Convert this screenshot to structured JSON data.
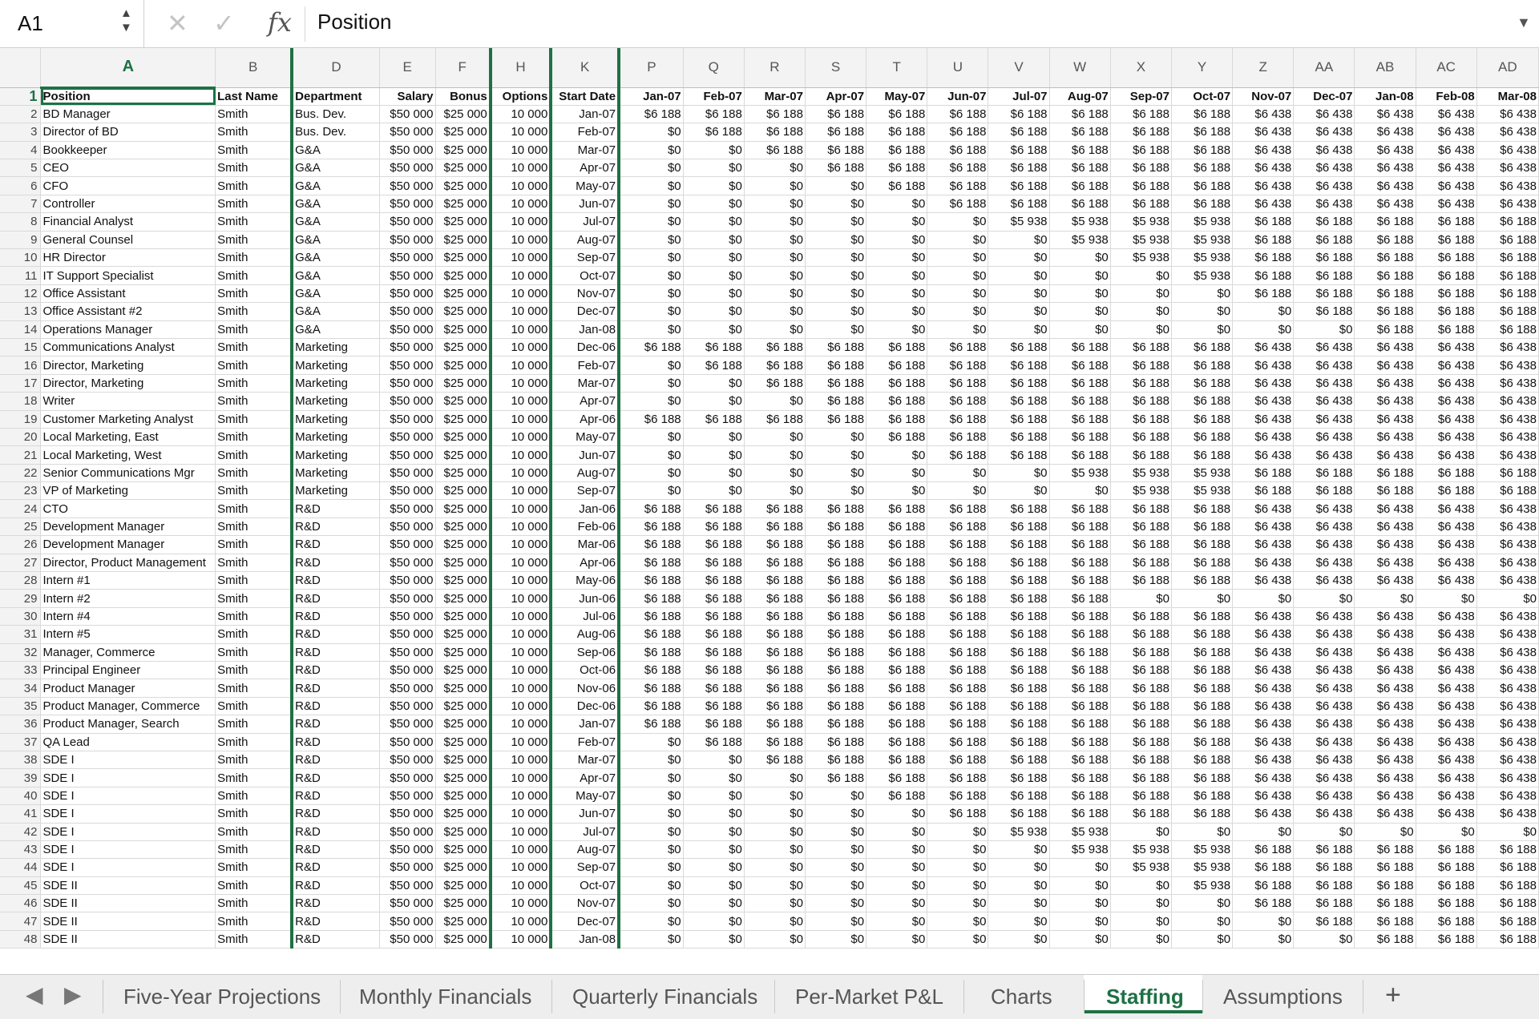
{
  "formula_bar": {
    "name_box": "A1",
    "fx_label": "fx",
    "formula": "Position"
  },
  "columns": [
    "A",
    "B",
    "D",
    "E",
    "F",
    "H",
    "K",
    "P",
    "Q",
    "R",
    "S",
    "T",
    "U",
    "V",
    "W",
    "X",
    "Y",
    "Z",
    "AA",
    "AB",
    "AC",
    "AD"
  ],
  "headers": [
    "Position",
    "Last Name",
    "Department",
    "Salary",
    "Bonus",
    "Options",
    "Start Date",
    "Jan-07",
    "Feb-07",
    "Mar-07",
    "Apr-07",
    "May-07",
    "Jun-07",
    "Jul-07",
    "Aug-07",
    "Sep-07",
    "Oct-07",
    "Nov-07",
    "Dec-07",
    "Jan-08",
    "Feb-08",
    "Mar-08"
  ],
  "rows": [
    [
      "BD Manager",
      "Smith",
      "Bus. Dev.",
      "$50 000",
      "$25 000",
      "10 000",
      "Jan-07",
      "$6 188",
      "$6 188",
      "$6 188",
      "$6 188",
      "$6 188",
      "$6 188",
      "$6 188",
      "$6 188",
      "$6 188",
      "$6 188",
      "$6 438",
      "$6 438",
      "$6 438",
      "$6 438",
      "$6 438"
    ],
    [
      "Director of BD",
      "Smith",
      "Bus. Dev.",
      "$50 000",
      "$25 000",
      "10 000",
      "Feb-07",
      "$0",
      "$6 188",
      "$6 188",
      "$6 188",
      "$6 188",
      "$6 188",
      "$6 188",
      "$6 188",
      "$6 188",
      "$6 188",
      "$6 438",
      "$6 438",
      "$6 438",
      "$6 438",
      "$6 438"
    ],
    [
      "Bookkeeper",
      "Smith",
      "G&A",
      "$50 000",
      "$25 000",
      "10 000",
      "Mar-07",
      "$0",
      "$0",
      "$6 188",
      "$6 188",
      "$6 188",
      "$6 188",
      "$6 188",
      "$6 188",
      "$6 188",
      "$6 188",
      "$6 438",
      "$6 438",
      "$6 438",
      "$6 438",
      "$6 438"
    ],
    [
      "CEO",
      "Smith",
      "G&A",
      "$50 000",
      "$25 000",
      "10 000",
      "Apr-07",
      "$0",
      "$0",
      "$0",
      "$6 188",
      "$6 188",
      "$6 188",
      "$6 188",
      "$6 188",
      "$6 188",
      "$6 188",
      "$6 438",
      "$6 438",
      "$6 438",
      "$6 438",
      "$6 438"
    ],
    [
      "CFO",
      "Smith",
      "G&A",
      "$50 000",
      "$25 000",
      "10 000",
      "May-07",
      "$0",
      "$0",
      "$0",
      "$0",
      "$6 188",
      "$6 188",
      "$6 188",
      "$6 188",
      "$6 188",
      "$6 188",
      "$6 438",
      "$6 438",
      "$6 438",
      "$6 438",
      "$6 438"
    ],
    [
      "Controller",
      "Smith",
      "G&A",
      "$50 000",
      "$25 000",
      "10 000",
      "Jun-07",
      "$0",
      "$0",
      "$0",
      "$0",
      "$0",
      "$6 188",
      "$6 188",
      "$6 188",
      "$6 188",
      "$6 188",
      "$6 438",
      "$6 438",
      "$6 438",
      "$6 438",
      "$6 438"
    ],
    [
      "Financial Analyst",
      "Smith",
      "G&A",
      "$50 000",
      "$25 000",
      "10 000",
      "Jul-07",
      "$0",
      "$0",
      "$0",
      "$0",
      "$0",
      "$0",
      "$5 938",
      "$5 938",
      "$5 938",
      "$5 938",
      "$6 188",
      "$6 188",
      "$6 188",
      "$6 188",
      "$6 188"
    ],
    [
      "General Counsel",
      "Smith",
      "G&A",
      "$50 000",
      "$25 000",
      "10 000",
      "Aug-07",
      "$0",
      "$0",
      "$0",
      "$0",
      "$0",
      "$0",
      "$0",
      "$5 938",
      "$5 938",
      "$5 938",
      "$6 188",
      "$6 188",
      "$6 188",
      "$6 188",
      "$6 188"
    ],
    [
      "HR Director",
      "Smith",
      "G&A",
      "$50 000",
      "$25 000",
      "10 000",
      "Sep-07",
      "$0",
      "$0",
      "$0",
      "$0",
      "$0",
      "$0",
      "$0",
      "$0",
      "$5 938",
      "$5 938",
      "$6 188",
      "$6 188",
      "$6 188",
      "$6 188",
      "$6 188"
    ],
    [
      "IT Support Specialist",
      "Smith",
      "G&A",
      "$50 000",
      "$25 000",
      "10 000",
      "Oct-07",
      "$0",
      "$0",
      "$0",
      "$0",
      "$0",
      "$0",
      "$0",
      "$0",
      "$0",
      "$5 938",
      "$6 188",
      "$6 188",
      "$6 188",
      "$6 188",
      "$6 188"
    ],
    [
      "Office Assistant",
      "Smith",
      "G&A",
      "$50 000",
      "$25 000",
      "10 000",
      "Nov-07",
      "$0",
      "$0",
      "$0",
      "$0",
      "$0",
      "$0",
      "$0",
      "$0",
      "$0",
      "$0",
      "$6 188",
      "$6 188",
      "$6 188",
      "$6 188",
      "$6 188"
    ],
    [
      "Office Assistant #2",
      "Smith",
      "G&A",
      "$50 000",
      "$25 000",
      "10 000",
      "Dec-07",
      "$0",
      "$0",
      "$0",
      "$0",
      "$0",
      "$0",
      "$0",
      "$0",
      "$0",
      "$0",
      "$0",
      "$6 188",
      "$6 188",
      "$6 188",
      "$6 188"
    ],
    [
      "Operations Manager",
      "Smith",
      "G&A",
      "$50 000",
      "$25 000",
      "10 000",
      "Jan-08",
      "$0",
      "$0",
      "$0",
      "$0",
      "$0",
      "$0",
      "$0",
      "$0",
      "$0",
      "$0",
      "$0",
      "$0",
      "$6 188",
      "$6 188",
      "$6 188"
    ],
    [
      "Communications Analyst",
      "Smith",
      "Marketing",
      "$50 000",
      "$25 000",
      "10 000",
      "Dec-06",
      "$6 188",
      "$6 188",
      "$6 188",
      "$6 188",
      "$6 188",
      "$6 188",
      "$6 188",
      "$6 188",
      "$6 188",
      "$6 188",
      "$6 438",
      "$6 438",
      "$6 438",
      "$6 438",
      "$6 438"
    ],
    [
      "Director, Marketing",
      "Smith",
      "Marketing",
      "$50 000",
      "$25 000",
      "10 000",
      "Feb-07",
      "$0",
      "$6 188",
      "$6 188",
      "$6 188",
      "$6 188",
      "$6 188",
      "$6 188",
      "$6 188",
      "$6 188",
      "$6 188",
      "$6 438",
      "$6 438",
      "$6 438",
      "$6 438",
      "$6 438"
    ],
    [
      "Director, Marketing",
      "Smith",
      "Marketing",
      "$50 000",
      "$25 000",
      "10 000",
      "Mar-07",
      "$0",
      "$0",
      "$6 188",
      "$6 188",
      "$6 188",
      "$6 188",
      "$6 188",
      "$6 188",
      "$6 188",
      "$6 188",
      "$6 438",
      "$6 438",
      "$6 438",
      "$6 438",
      "$6 438"
    ],
    [
      "Writer",
      "Smith",
      "Marketing",
      "$50 000",
      "$25 000",
      "10 000",
      "Apr-07",
      "$0",
      "$0",
      "$0",
      "$6 188",
      "$6 188",
      "$6 188",
      "$6 188",
      "$6 188",
      "$6 188",
      "$6 188",
      "$6 438",
      "$6 438",
      "$6 438",
      "$6 438",
      "$6 438"
    ],
    [
      "Customer Marketing Analyst",
      "Smith",
      "Marketing",
      "$50 000",
      "$25 000",
      "10 000",
      "Apr-06",
      "$6 188",
      "$6 188",
      "$6 188",
      "$6 188",
      "$6 188",
      "$6 188",
      "$6 188",
      "$6 188",
      "$6 188",
      "$6 188",
      "$6 438",
      "$6 438",
      "$6 438",
      "$6 438",
      "$6 438"
    ],
    [
      "Local Marketing, East",
      "Smith",
      "Marketing",
      "$50 000",
      "$25 000",
      "10 000",
      "May-07",
      "$0",
      "$0",
      "$0",
      "$0",
      "$6 188",
      "$6 188",
      "$6 188",
      "$6 188",
      "$6 188",
      "$6 188",
      "$6 438",
      "$6 438",
      "$6 438",
      "$6 438",
      "$6 438"
    ],
    [
      "Local Marketing, West",
      "Smith",
      "Marketing",
      "$50 000",
      "$25 000",
      "10 000",
      "Jun-07",
      "$0",
      "$0",
      "$0",
      "$0",
      "$0",
      "$6 188",
      "$6 188",
      "$6 188",
      "$6 188",
      "$6 188",
      "$6 438",
      "$6 438",
      "$6 438",
      "$6 438",
      "$6 438"
    ],
    [
      "Senior Communications Mgr",
      "Smith",
      "Marketing",
      "$50 000",
      "$25 000",
      "10 000",
      "Aug-07",
      "$0",
      "$0",
      "$0",
      "$0",
      "$0",
      "$0",
      "$0",
      "$5 938",
      "$5 938",
      "$5 938",
      "$6 188",
      "$6 188",
      "$6 188",
      "$6 188",
      "$6 188"
    ],
    [
      "VP of Marketing",
      "Smith",
      "Marketing",
      "$50 000",
      "$25 000",
      "10 000",
      "Sep-07",
      "$0",
      "$0",
      "$0",
      "$0",
      "$0",
      "$0",
      "$0",
      "$0",
      "$5 938",
      "$5 938",
      "$6 188",
      "$6 188",
      "$6 188",
      "$6 188",
      "$6 188"
    ],
    [
      "CTO",
      "Smith",
      "R&D",
      "$50 000",
      "$25 000",
      "10 000",
      "Jan-06",
      "$6 188",
      "$6 188",
      "$6 188",
      "$6 188",
      "$6 188",
      "$6 188",
      "$6 188",
      "$6 188",
      "$6 188",
      "$6 188",
      "$6 438",
      "$6 438",
      "$6 438",
      "$6 438",
      "$6 438"
    ],
    [
      "Development Manager",
      "Smith",
      "R&D",
      "$50 000",
      "$25 000",
      "10 000",
      "Feb-06",
      "$6 188",
      "$6 188",
      "$6 188",
      "$6 188",
      "$6 188",
      "$6 188",
      "$6 188",
      "$6 188",
      "$6 188",
      "$6 188",
      "$6 438",
      "$6 438",
      "$6 438",
      "$6 438",
      "$6 438"
    ],
    [
      "Development Manager",
      "Smith",
      "R&D",
      "$50 000",
      "$25 000",
      "10 000",
      "Mar-06",
      "$6 188",
      "$6 188",
      "$6 188",
      "$6 188",
      "$6 188",
      "$6 188",
      "$6 188",
      "$6 188",
      "$6 188",
      "$6 188",
      "$6 438",
      "$6 438",
      "$6 438",
      "$6 438",
      "$6 438"
    ],
    [
      "Director, Product Management",
      "Smith",
      "R&D",
      "$50 000",
      "$25 000",
      "10 000",
      "Apr-06",
      "$6 188",
      "$6 188",
      "$6 188",
      "$6 188",
      "$6 188",
      "$6 188",
      "$6 188",
      "$6 188",
      "$6 188",
      "$6 188",
      "$6 438",
      "$6 438",
      "$6 438",
      "$6 438",
      "$6 438"
    ],
    [
      "Intern #1",
      "Smith",
      "R&D",
      "$50 000",
      "$25 000",
      "10 000",
      "May-06",
      "$6 188",
      "$6 188",
      "$6 188",
      "$6 188",
      "$6 188",
      "$6 188",
      "$6 188",
      "$6 188",
      "$6 188",
      "$6 188",
      "$6 438",
      "$6 438",
      "$6 438",
      "$6 438",
      "$6 438"
    ],
    [
      "Intern #2",
      "Smith",
      "R&D",
      "$50 000",
      "$25 000",
      "10 000",
      "Jun-06",
      "$6 188",
      "$6 188",
      "$6 188",
      "$6 188",
      "$6 188",
      "$6 188",
      "$6 188",
      "$6 188",
      "$0",
      "$0",
      "$0",
      "$0",
      "$0",
      "$0",
      "$0"
    ],
    [
      "Intern #4",
      "Smith",
      "R&D",
      "$50 000",
      "$25 000",
      "10 000",
      "Jul-06",
      "$6 188",
      "$6 188",
      "$6 188",
      "$6 188",
      "$6 188",
      "$6 188",
      "$6 188",
      "$6 188",
      "$6 188",
      "$6 188",
      "$6 438",
      "$6 438",
      "$6 438",
      "$6 438",
      "$6 438"
    ],
    [
      "Intern #5",
      "Smith",
      "R&D",
      "$50 000",
      "$25 000",
      "10 000",
      "Aug-06",
      "$6 188",
      "$6 188",
      "$6 188",
      "$6 188",
      "$6 188",
      "$6 188",
      "$6 188",
      "$6 188",
      "$6 188",
      "$6 188",
      "$6 438",
      "$6 438",
      "$6 438",
      "$6 438",
      "$6 438"
    ],
    [
      "Manager, Commerce",
      "Smith",
      "R&D",
      "$50 000",
      "$25 000",
      "10 000",
      "Sep-06",
      "$6 188",
      "$6 188",
      "$6 188",
      "$6 188",
      "$6 188",
      "$6 188",
      "$6 188",
      "$6 188",
      "$6 188",
      "$6 188",
      "$6 438",
      "$6 438",
      "$6 438",
      "$6 438",
      "$6 438"
    ],
    [
      "Principal Engineer",
      "Smith",
      "R&D",
      "$50 000",
      "$25 000",
      "10 000",
      "Oct-06",
      "$6 188",
      "$6 188",
      "$6 188",
      "$6 188",
      "$6 188",
      "$6 188",
      "$6 188",
      "$6 188",
      "$6 188",
      "$6 188",
      "$6 438",
      "$6 438",
      "$6 438",
      "$6 438",
      "$6 438"
    ],
    [
      "Product Manager",
      "Smith",
      "R&D",
      "$50 000",
      "$25 000",
      "10 000",
      "Nov-06",
      "$6 188",
      "$6 188",
      "$6 188",
      "$6 188",
      "$6 188",
      "$6 188",
      "$6 188",
      "$6 188",
      "$6 188",
      "$6 188",
      "$6 438",
      "$6 438",
      "$6 438",
      "$6 438",
      "$6 438"
    ],
    [
      "Product Manager, Commerce",
      "Smith",
      "R&D",
      "$50 000",
      "$25 000",
      "10 000",
      "Dec-06",
      "$6 188",
      "$6 188",
      "$6 188",
      "$6 188",
      "$6 188",
      "$6 188",
      "$6 188",
      "$6 188",
      "$6 188",
      "$6 188",
      "$6 438",
      "$6 438",
      "$6 438",
      "$6 438",
      "$6 438"
    ],
    [
      "Product Manager, Search",
      "Smith",
      "R&D",
      "$50 000",
      "$25 000",
      "10 000",
      "Jan-07",
      "$6 188",
      "$6 188",
      "$6 188",
      "$6 188",
      "$6 188",
      "$6 188",
      "$6 188",
      "$6 188",
      "$6 188",
      "$6 188",
      "$6 438",
      "$6 438",
      "$6 438",
      "$6 438",
      "$6 438"
    ],
    [
      "QA Lead",
      "Smith",
      "R&D",
      "$50 000",
      "$25 000",
      "10 000",
      "Feb-07",
      "$0",
      "$6 188",
      "$6 188",
      "$6 188",
      "$6 188",
      "$6 188",
      "$6 188",
      "$6 188",
      "$6 188",
      "$6 188",
      "$6 438",
      "$6 438",
      "$6 438",
      "$6 438",
      "$6 438"
    ],
    [
      "SDE I",
      "Smith",
      "R&D",
      "$50 000",
      "$25 000",
      "10 000",
      "Mar-07",
      "$0",
      "$0",
      "$6 188",
      "$6 188",
      "$6 188",
      "$6 188",
      "$6 188",
      "$6 188",
      "$6 188",
      "$6 188",
      "$6 438",
      "$6 438",
      "$6 438",
      "$6 438",
      "$6 438"
    ],
    [
      "SDE I",
      "Smith",
      "R&D",
      "$50 000",
      "$25 000",
      "10 000",
      "Apr-07",
      "$0",
      "$0",
      "$0",
      "$6 188",
      "$6 188",
      "$6 188",
      "$6 188",
      "$6 188",
      "$6 188",
      "$6 188",
      "$6 438",
      "$6 438",
      "$6 438",
      "$6 438",
      "$6 438"
    ],
    [
      "SDE I",
      "Smith",
      "R&D",
      "$50 000",
      "$25 000",
      "10 000",
      "May-07",
      "$0",
      "$0",
      "$0",
      "$0",
      "$6 188",
      "$6 188",
      "$6 188",
      "$6 188",
      "$6 188",
      "$6 188",
      "$6 438",
      "$6 438",
      "$6 438",
      "$6 438",
      "$6 438"
    ],
    [
      "SDE I",
      "Smith",
      "R&D",
      "$50 000",
      "$25 000",
      "10 000",
      "Jun-07",
      "$0",
      "$0",
      "$0",
      "$0",
      "$0",
      "$6 188",
      "$6 188",
      "$6 188",
      "$6 188",
      "$6 188",
      "$6 438",
      "$6 438",
      "$6 438",
      "$6 438",
      "$6 438"
    ],
    [
      "SDE I",
      "Smith",
      "R&D",
      "$50 000",
      "$25 000",
      "10 000",
      "Jul-07",
      "$0",
      "$0",
      "$0",
      "$0",
      "$0",
      "$0",
      "$5 938",
      "$5 938",
      "$0",
      "$0",
      "$0",
      "$0",
      "$0",
      "$0",
      "$0"
    ],
    [
      "SDE I",
      "Smith",
      "R&D",
      "$50 000",
      "$25 000",
      "10 000",
      "Aug-07",
      "$0",
      "$0",
      "$0",
      "$0",
      "$0",
      "$0",
      "$0",
      "$5 938",
      "$5 938",
      "$5 938",
      "$6 188",
      "$6 188",
      "$6 188",
      "$6 188",
      "$6 188"
    ],
    [
      "SDE I",
      "Smith",
      "R&D",
      "$50 000",
      "$25 000",
      "10 000",
      "Sep-07",
      "$0",
      "$0",
      "$0",
      "$0",
      "$0",
      "$0",
      "$0",
      "$0",
      "$5 938",
      "$5 938",
      "$6 188",
      "$6 188",
      "$6 188",
      "$6 188",
      "$6 188"
    ],
    [
      "SDE II",
      "Smith",
      "R&D",
      "$50 000",
      "$25 000",
      "10 000",
      "Oct-07",
      "$0",
      "$0",
      "$0",
      "$0",
      "$0",
      "$0",
      "$0",
      "$0",
      "$0",
      "$5 938",
      "$6 188",
      "$6 188",
      "$6 188",
      "$6 188",
      "$6 188"
    ],
    [
      "SDE II",
      "Smith",
      "R&D",
      "$50 000",
      "$25 000",
      "10 000",
      "Nov-07",
      "$0",
      "$0",
      "$0",
      "$0",
      "$0",
      "$0",
      "$0",
      "$0",
      "$0",
      "$0",
      "$6 188",
      "$6 188",
      "$6 188",
      "$6 188",
      "$6 188"
    ],
    [
      "SDE II",
      "Smith",
      "R&D",
      "$50 000",
      "$25 000",
      "10 000",
      "Dec-07",
      "$0",
      "$0",
      "$0",
      "$0",
      "$0",
      "$0",
      "$0",
      "$0",
      "$0",
      "$0",
      "$0",
      "$6 188",
      "$6 188",
      "$6 188",
      "$6 188"
    ],
    [
      "SDE II",
      "Smith",
      "R&D",
      "$50 000",
      "$25 000",
      "10 000",
      "Jan-08",
      "$0",
      "$0",
      "$0",
      "$0",
      "$0",
      "$0",
      "$0",
      "$0",
      "$0",
      "$0",
      "$0",
      "$0",
      "$6 188",
      "$6 188",
      "$6 188"
    ]
  ],
  "tabs": [
    "Five-Year Projections",
    "Monthly Financials",
    "Quarterly Financials",
    "Per-Market P&L",
    "Charts",
    "Staffing",
    "Assumptions"
  ],
  "active_tab": "Staffing",
  "accent_color": "#1e7145"
}
